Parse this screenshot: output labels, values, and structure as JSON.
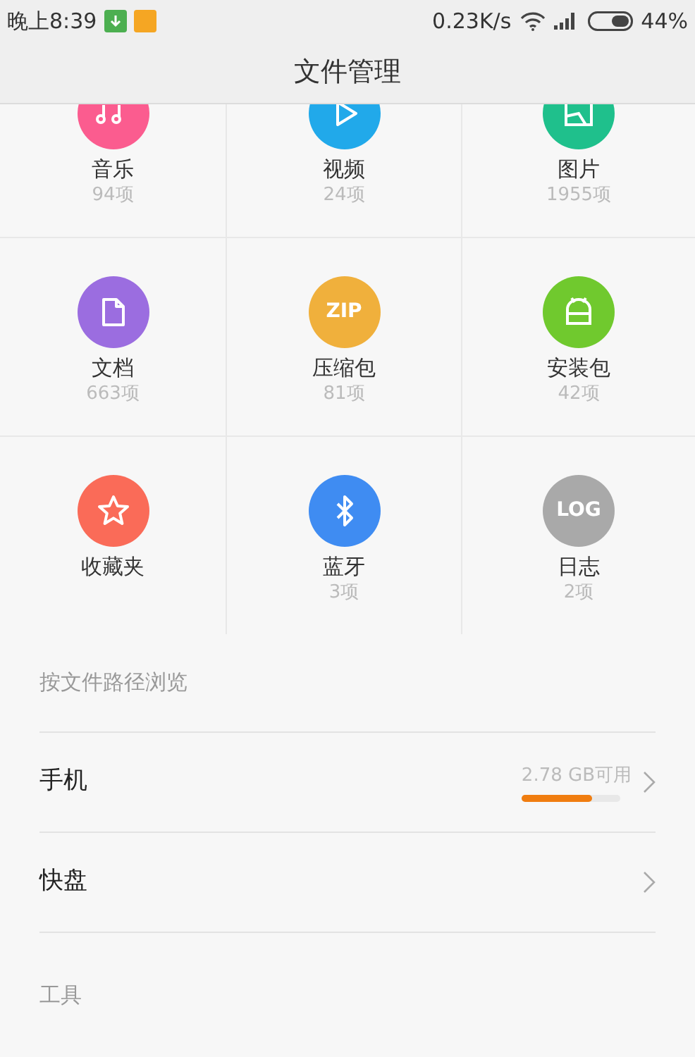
{
  "status_bar": {
    "time": "晚上8:39",
    "speed": "0.23K/s",
    "battery": "44%"
  },
  "title": "文件管理",
  "categories": [
    {
      "label": "音乐",
      "count": "94项",
      "color": "#fb5c8f",
      "kind": "music"
    },
    {
      "label": "视频",
      "count": "24项",
      "color": "#21a9ea",
      "kind": "video"
    },
    {
      "label": "图片",
      "count": "1955项",
      "color": "#1fc08c",
      "kind": "image"
    },
    {
      "label": "文档",
      "count": "663项",
      "color": "#9b6de0",
      "kind": "doc"
    },
    {
      "label": "压缩包",
      "count": "81项",
      "color": "#f0b03c",
      "kind": "badge",
      "icon_text": "ZIP"
    },
    {
      "label": "安装包",
      "count": "42项",
      "color": "#70c92e",
      "kind": "apk"
    },
    {
      "label": "收藏夹",
      "color": "#fa6b58",
      "kind": "star"
    },
    {
      "label": "蓝牙",
      "count": "3项",
      "color": "#3f8cf2",
      "kind": "bluetooth"
    },
    {
      "label": "日志",
      "count": "2项",
      "color": "#a9a9a9",
      "kind": "badge",
      "icon_text": "LOG"
    }
  ],
  "browse": {
    "heading": "按文件路径浏览",
    "items": [
      {
        "label": "手机",
        "storage": "2.78 GB可用",
        "level": 0.71
      },
      {
        "label": "快盘"
      }
    ]
  },
  "tools": {
    "heading": "工具"
  }
}
